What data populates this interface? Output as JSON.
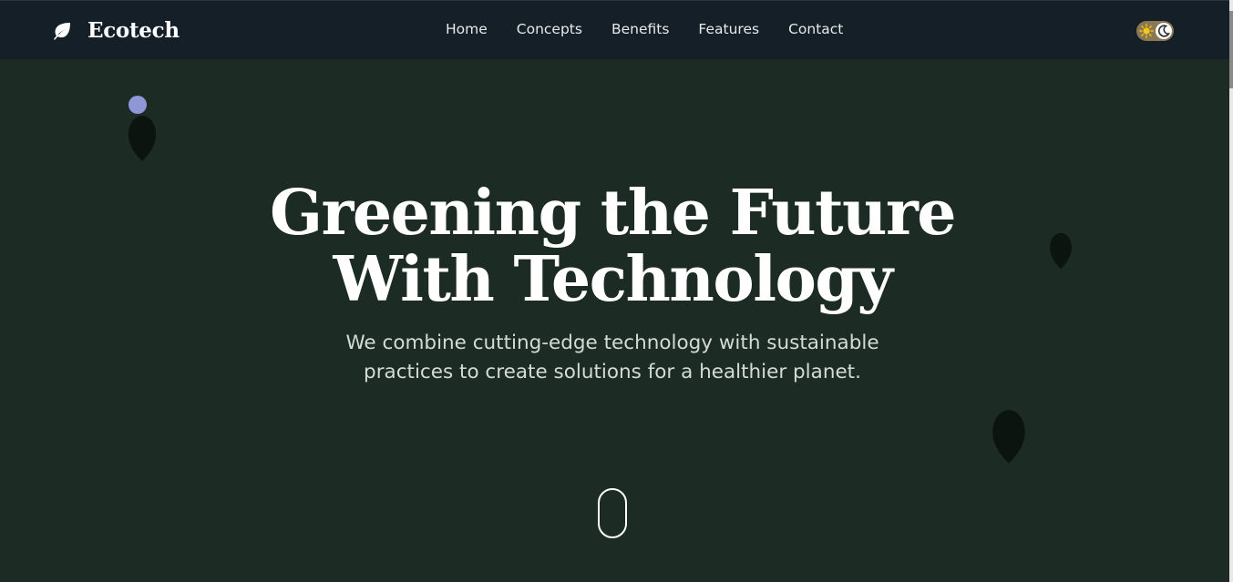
{
  "brand": {
    "name": "Ecotech",
    "icon": "leaf-icon"
  },
  "nav": {
    "links": [
      {
        "label": "Home"
      },
      {
        "label": "Concepts"
      },
      {
        "label": "Benefits"
      },
      {
        "label": "Features"
      },
      {
        "label": "Contact"
      }
    ]
  },
  "theme_toggle": {
    "light_icon": "sun-icon",
    "dark_icon": "moon-icon"
  },
  "hero": {
    "title_line1": "Greening the Future",
    "title_line2": "With Technology",
    "subtitle": "We combine cutting-edge technology with sustainable practices to create solutions for a healthier planet."
  },
  "colors": {
    "nav_bg": "#141f27",
    "hero_bg": "#1c2c24",
    "leaf": "#0b140f",
    "dot": "#8f97d6",
    "toggle_bg": "#8a7852"
  }
}
